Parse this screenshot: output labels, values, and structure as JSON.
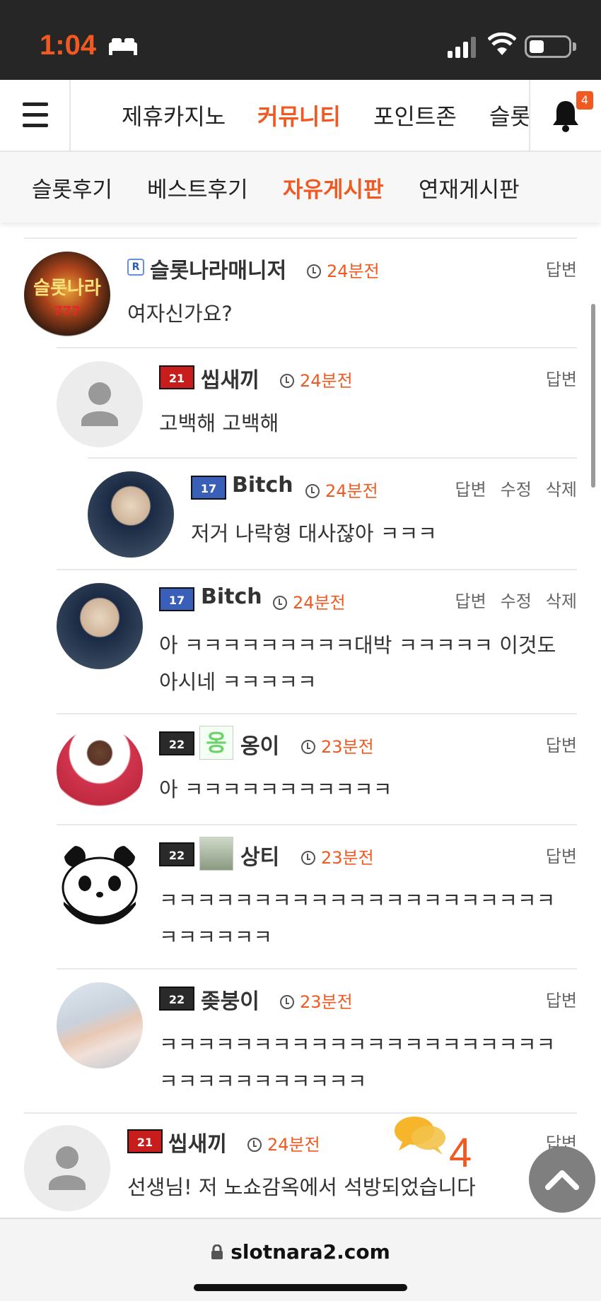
{
  "status_bar": {
    "time": "1:04"
  },
  "top_nav": {
    "items": [
      "제휴카지노",
      "커뮤니티",
      "포인트존",
      "슬롯"
    ],
    "active": "커뮤니티",
    "notification_count": "4",
    "menu_icon": "hamburger-icon",
    "bell_icon": "bell-icon"
  },
  "sub_nav": {
    "items": [
      "슬롯후기",
      "베스트후기",
      "자유게시판",
      "연재게시판"
    ],
    "active": "자유게시판"
  },
  "comments": [
    {
      "level": "R",
      "name": "슬롯나라매니저",
      "time": "24분전",
      "actions": [
        "답변"
      ],
      "text": "여자신가요?"
    },
    {
      "level": "21",
      "name": "씹새끼",
      "time": "24분전",
      "actions": [
        "답변"
      ],
      "text": "고백해 고백해"
    },
    {
      "level": "17",
      "name": "Bitch",
      "time": "24분전",
      "actions": [
        "답변",
        "수정",
        "삭제"
      ],
      "text": "저거 나락형 대사잖아 ㅋㅋㅋ"
    },
    {
      "level": "17",
      "name": "Bitch",
      "time": "24분전",
      "actions": [
        "답변",
        "수정",
        "삭제"
      ],
      "text": "아 ㅋㅋㅋㅋㅋㅋㅋㅋㅋ대박 ㅋㅋㅋㅋㅋ 이것도 아시네 ㅋㅋㅋㅋㅋ"
    },
    {
      "level": "22",
      "badge_text": "옹",
      "name": "옹이",
      "time": "23분전",
      "actions": [
        "답변"
      ],
      "text": "아 ㅋㅋㅋㅋㅋㅋㅋㅋㅋㅋㅋ"
    },
    {
      "level": "22",
      "name": "상티",
      "time": "23분전",
      "actions": [
        "답변"
      ],
      "text": "ㅋㅋㅋㅋㅋㅋㅋㅋㅋㅋㅋㅋㅋㅋㅋㅋㅋㅋㅋㅋㅋㅋㅋㅋㅋㅋㅋ"
    },
    {
      "level": "22",
      "name": "좆붕이",
      "time": "23분전",
      "actions": [
        "답변"
      ],
      "text": "ㅋㅋㅋㅋㅋㅋㅋㅋㅋㅋㅋㅋㅋㅋㅋㅋㅋㅋㅋㅋㅋㅋㅋㅋㅋㅋㅋㅋㅋㅋㅋㅋ"
    },
    {
      "level": "21",
      "name": "씹새끼",
      "time": "24분전",
      "actions": [
        "답변"
      ],
      "text": "선생님! 저 노쇼감옥에서 석방되었습니다"
    }
  ],
  "chat_widget": {
    "count": "4"
  },
  "browser": {
    "url": "slotnara2.com"
  }
}
